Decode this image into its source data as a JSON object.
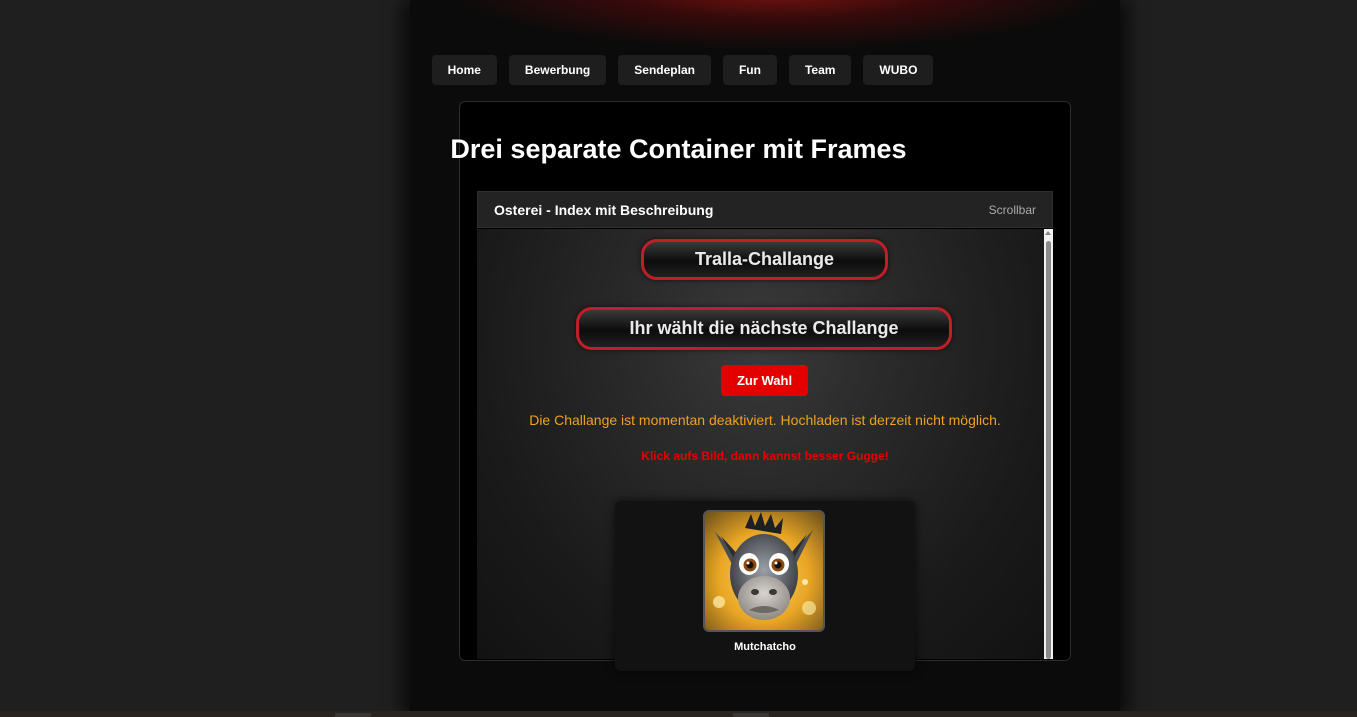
{
  "nav": {
    "items": [
      {
        "label": "Home"
      },
      {
        "label": "Bewerbung"
      },
      {
        "label": "Sendeplan"
      },
      {
        "label": "Fun"
      },
      {
        "label": "Team"
      },
      {
        "label": "WUBO"
      }
    ]
  },
  "main": {
    "title": "Drei separate Container mit Frames",
    "panel": {
      "title": "Osterei - Index mit Beschreibung",
      "scroll_hint": "Scrollbar"
    },
    "challenge": {
      "current_label": "Tralla-Challange",
      "vote_heading": "Ihr wählt die nächste Challange",
      "vote_button": "Zur Wahl",
      "notice": "Die Challange ist momentan deaktiviert. Hochladen ist derzeit nicht möglich.",
      "hint": "Klick aufs Bild, dann kannst besser Gugge!"
    },
    "entries": [
      {
        "name": "Mutchatcho",
        "image": "donkey-portrait"
      }
    ]
  },
  "colors": {
    "accent_red": "#e50000",
    "pill_border": "#c01f26",
    "notice_orange": "#f0a020",
    "background": "#1f1f1f",
    "column": "#0b0b0b"
  }
}
